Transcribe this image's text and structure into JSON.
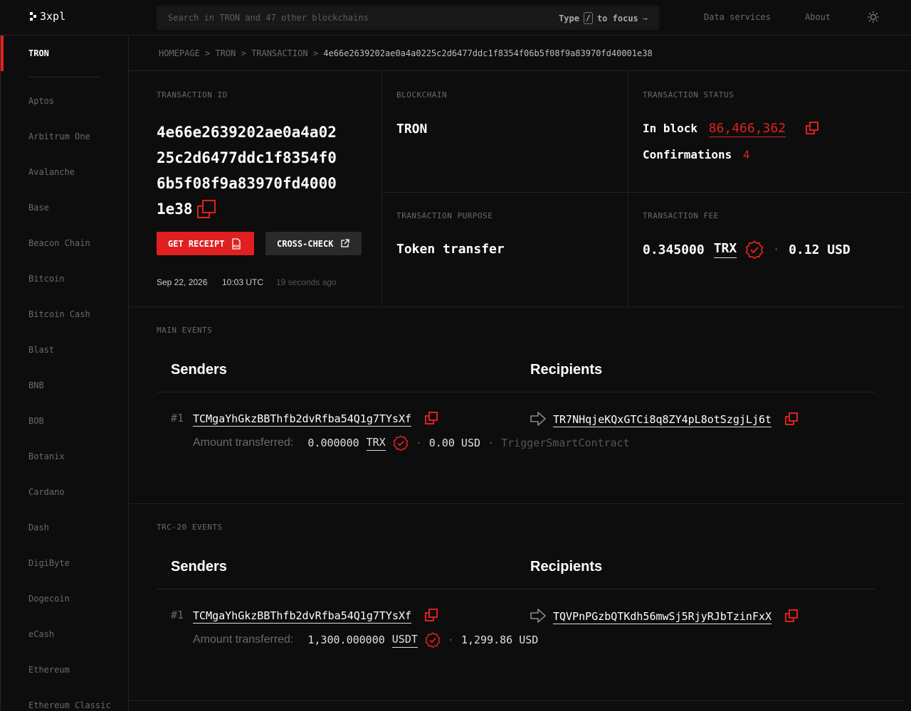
{
  "header": {
    "logo_text": "3xpl",
    "search_placeholder": "Search in TRON and 47 other blockchains",
    "search_hint_prefix": "Type",
    "search_hint_key": "/",
    "search_hint_suffix": "to focus",
    "search_hint_arrow": "→",
    "nav": [
      "Data services",
      "About"
    ],
    "theme_icon": "sun-icon"
  },
  "sidebar": {
    "active": "TRON",
    "items": [
      "Aptos",
      "Arbitrum One",
      "Avalanche",
      "Base",
      "Beacon Chain",
      "Bitcoin",
      "Bitcoin Cash",
      "Blast",
      "BNB",
      "BOB",
      "Botanix",
      "Cardano",
      "Dash",
      "DigiByte",
      "Dogecoin",
      "eCash",
      "Ethereum",
      "Ethereum Classic"
    ]
  },
  "breadcrumb": {
    "items": [
      "HOMEPAGE",
      "TRON",
      "TRANSACTION"
    ],
    "separator": ">",
    "current": "4e66e2639202ae0a4a0225c2d6477ddc1f8354f06b5f08f9a83970fd40001e38"
  },
  "summary": {
    "txid_label": "TRANSACTION ID",
    "txid": "4e66e2639202ae0a4a0225c2d6477ddc1f8354f06b5f08f9a83970fd40001e38",
    "receipt_button": "GET RECEIPT",
    "receipt_icon_text": "PDF",
    "crosscheck_button": "CROSS-CHECK",
    "date": "Sep 22, 2026",
    "time": "10:03 UTC",
    "ago": "19 seconds ago",
    "blockchain_label": "BLOCKCHAIN",
    "blockchain": "TRON",
    "status_label": "TRANSACTION STATUS",
    "in_block_label": "In block",
    "block_number": "86,466,362",
    "confirmations_label": "Confirmations",
    "confirmations": "4",
    "purpose_label": "TRANSACTION PURPOSE",
    "purpose": "Token transfer",
    "fee_label": "TRANSACTION FEE",
    "fee_amount": "0.345000",
    "fee_currency": "TRX",
    "fee_usd": "0.12 USD",
    "separator": "·"
  },
  "main_events": {
    "label": "MAIN EVENTS",
    "senders_header": "Senders",
    "recipients_header": "Recipients",
    "rows": [
      {
        "index": "#1",
        "sender": "TCMgaYhGkzBBThfb2dvRfba54Q1g7TYsXf",
        "recipient": "TR7NHqjeKQxGTCi8q8ZY4pL8otSzgjLj6t",
        "amount_label": "Amount transferred:",
        "amount": "0.000000",
        "currency": "TRX",
        "usd": "0.00 USD",
        "method": "TriggerSmartContract"
      }
    ]
  },
  "trc20_events": {
    "label": "TRC-20 EVENTS",
    "senders_header": "Senders",
    "recipients_header": "Recipients",
    "rows": [
      {
        "index": "#1",
        "sender": "TCMgaYhGkzBBThfb2dvRfba54Q1g7TYsXf",
        "recipient": "TQVPnPGzbQTKdh56mwSj5RjyRJbTzinFxX",
        "amount_label": "Amount transferred:",
        "amount": "1,300.000000",
        "currency": "USDT",
        "usd": "1,299.86 USD"
      }
    ]
  },
  "colors": {
    "accent": "#e02020",
    "background": "#0d0d0d",
    "border": "#222222",
    "muted": "#6a6a6a"
  }
}
